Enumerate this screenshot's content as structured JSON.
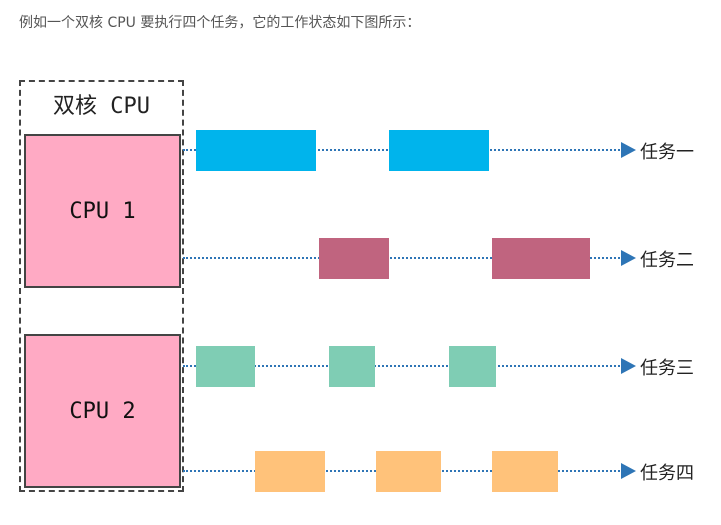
{
  "intro_text": "例如一个双核 CPU 要执行四个任务，它的工作状态如下图所示：",
  "diagram": {
    "outer_title": "双核 CPU",
    "cpus": [
      {
        "label": "CPU 1"
      },
      {
        "label": "CPU 2"
      }
    ],
    "tasks": [
      {
        "label": "任务一",
        "color": "#00b4ec"
      },
      {
        "label": "任务二",
        "color": "#c0647f"
      },
      {
        "label": "任务三",
        "color": "#7fcdb4"
      },
      {
        "label": "任务四",
        "color": "#ffc27a"
      }
    ],
    "line_color": "#2e75b6",
    "cpu_color": "#ffaac4"
  }
}
